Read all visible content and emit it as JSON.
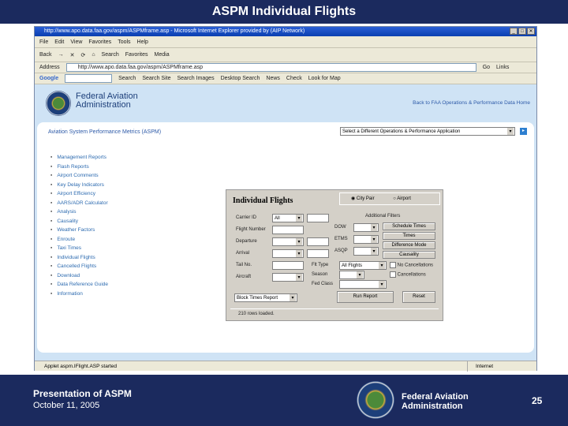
{
  "slide": {
    "title": "ASPM Individual Flights",
    "presentation": "Presentation of ASPM",
    "date": "October 11, 2005",
    "org_line1": "Federal Aviation",
    "org_line2": "Administration",
    "page_number": "25"
  },
  "browser": {
    "window_title": "http://www.apo.data.faa.gov/aspm/ASPMframe.asp - Microsoft Internet Explorer provided by (AIP Network)",
    "menu": [
      "File",
      "Edit",
      "View",
      "Favorites",
      "Tools",
      "Help"
    ],
    "toolbar": [
      "Back",
      "→",
      "✕",
      "⟳",
      "⌂",
      "Search",
      "Favorites",
      "Media"
    ],
    "address_label": "Address",
    "address": "http://www.apo.data.faa.gov/aspm/ASPMframe.asp",
    "go": "Go",
    "links": "Links",
    "google": {
      "label": "Google",
      "items": [
        "Search",
        "Search Site",
        "Search Images",
        "Desktop Search",
        "News",
        "Check",
        "Look for Map"
      ]
    },
    "status": "Applet aspm.IFlight.ASP started",
    "zone": "Internet"
  },
  "site": {
    "org_line1": "Federal Aviation",
    "org_line2": "Administration",
    "back_link": "Back to FAA Operations & Performance Data Home",
    "app_title": "Aviation System Performance Metrics (ASPM)",
    "app_select": "Select a Different Operations & Performance Application",
    "nav": [
      "Management Reports",
      "Flash Reports",
      "Airport Comments",
      "Key Delay Indicators",
      "Airport Efficiency",
      "AARS/ADR Calculator",
      "Analysis",
      "Causality",
      "Weather Factors",
      "Enroute",
      "Taxi Times",
      "Individual Flights",
      "Cancelled Flights",
      "Download",
      "Data Reference Guide",
      "Information"
    ]
  },
  "form": {
    "title": "Individual Flights",
    "radio_city_pair": "City Pair",
    "radio_airport": "Airport",
    "carrier_label": "Carrier ID",
    "carrier_value": "All",
    "flight_label": "Flight Number",
    "departure_label": "Departure",
    "arrival_label": "Arrival",
    "tail_label": "Tail No.",
    "aircraft_label": "Aircraft",
    "additional_filters": "Additional Filters",
    "dow_label": "DOW",
    "etms_label": "ETMS",
    "asqp_label": "ASQP",
    "btn_schedule": "Schedule Times",
    "btn_times": "Times",
    "btn_difference": "Difference Mode",
    "btn_causality": "Causality",
    "flt_type_label": "Flt Type",
    "flt_type_value": "All Flights",
    "season_label": "Season",
    "fed_class_label": "Fed Class",
    "chk_no_cancel": "No Cancellations",
    "chk_cancel": "Cancellations",
    "report_value": "Block Times Report",
    "run": "Run Report",
    "reset": "Reset",
    "status": "210 rows loaded."
  }
}
